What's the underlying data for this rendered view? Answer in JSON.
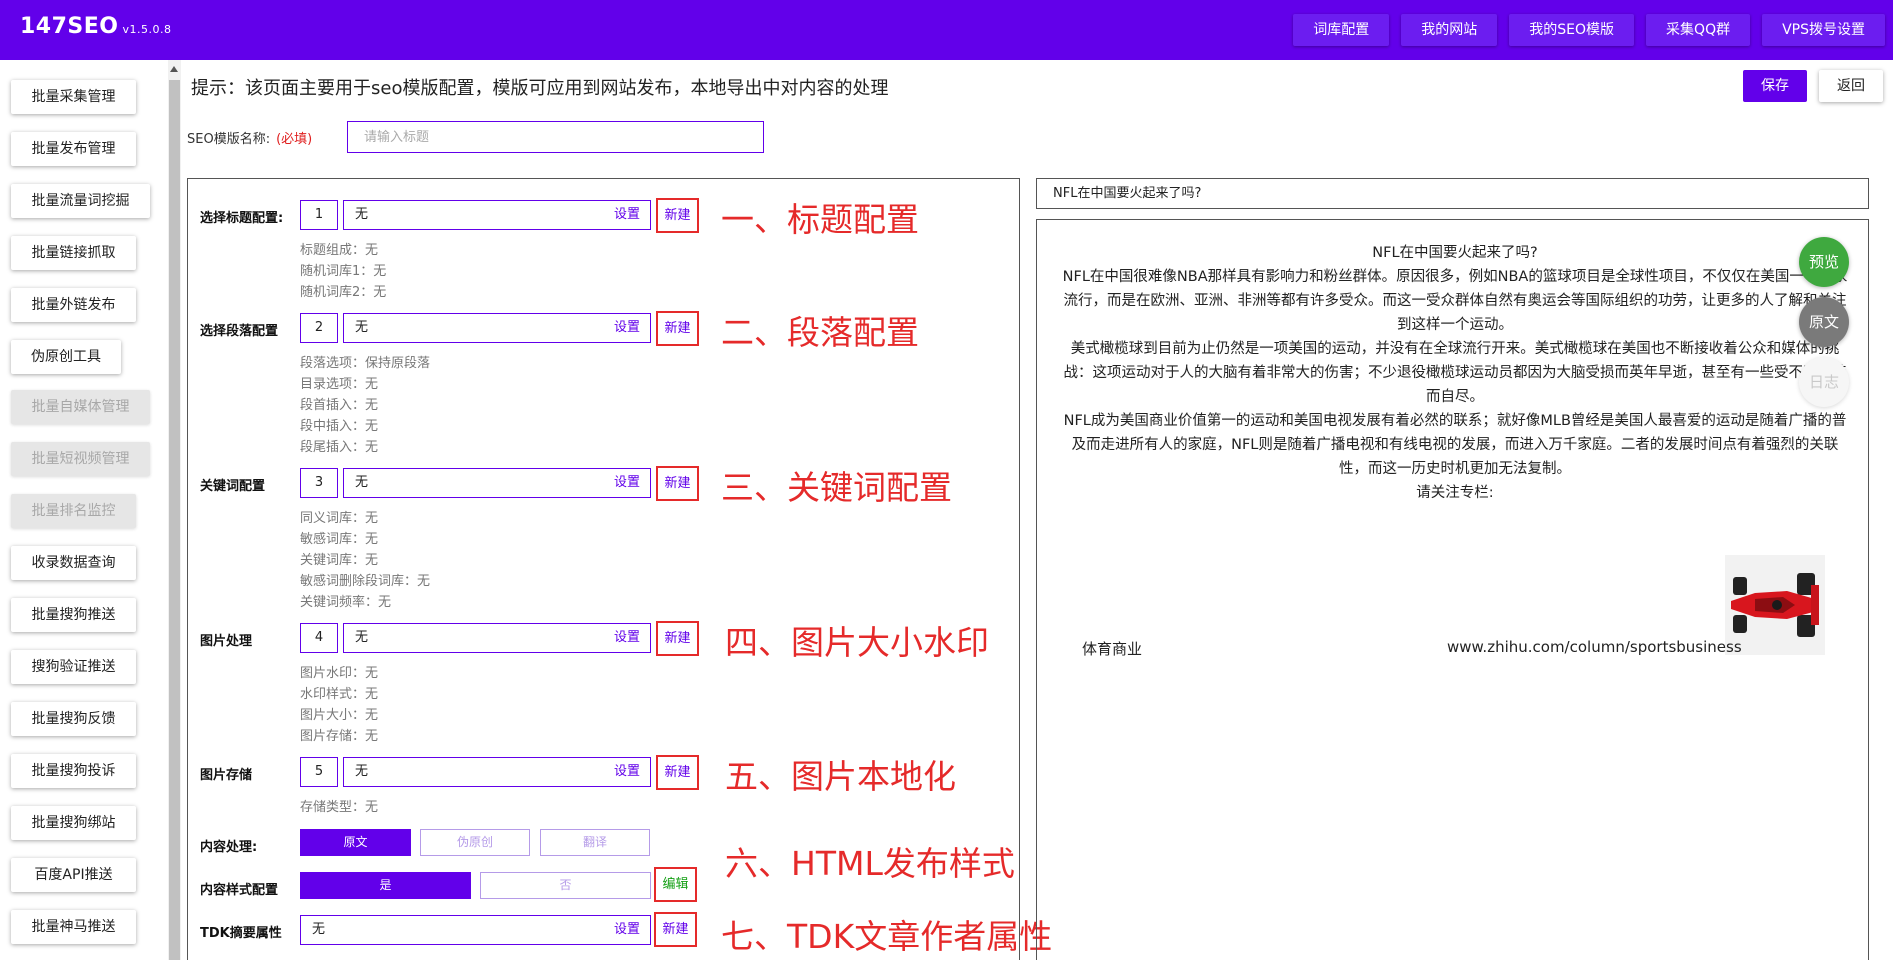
{
  "header": {
    "brand": "147SEO",
    "version": "v1.5.0.8",
    "nav": [
      "词库配置",
      "我的网站",
      "我的SEO模版",
      "采集QQ群",
      "VPS拨号设置"
    ]
  },
  "sidebar": {
    "items": [
      {
        "label": "批量采集管理",
        "disabled": false
      },
      {
        "label": "批量发布管理",
        "disabled": false
      },
      {
        "label": "批量流量词挖掘",
        "disabled": false
      },
      {
        "label": "批量链接抓取",
        "disabled": false
      },
      {
        "label": "批量外链发布",
        "disabled": false
      },
      {
        "label": "伪原创工具",
        "disabled": false
      },
      {
        "label": "批量自媒体管理",
        "disabled": true
      },
      {
        "label": "批量短视频管理",
        "disabled": true
      },
      {
        "label": "批量排名监控",
        "disabled": true
      },
      {
        "label": "收录数据查询",
        "disabled": false
      },
      {
        "label": "批量搜狗推送",
        "disabled": false
      },
      {
        "label": "搜狗验证推送",
        "disabled": false
      },
      {
        "label": "批量搜狗反馈",
        "disabled": false
      },
      {
        "label": "批量搜狗投诉",
        "disabled": false
      },
      {
        "label": "批量搜狗绑站",
        "disabled": false
      },
      {
        "label": "百度API推送",
        "disabled": false
      },
      {
        "label": "批量神马推送",
        "disabled": false
      }
    ]
  },
  "main": {
    "tip": "提示：该页面主要用于seo模版配置，模版可应用到网站发布，本地导出中对内容的处理",
    "save": "保存",
    "back": "返回",
    "template_label": "SEO模版名称:",
    "template_required": "(必填)",
    "template_placeholder": "请输入标题"
  },
  "config": {
    "rows": [
      {
        "label": "选择标题配置:",
        "num": "1",
        "value": "无",
        "set": "设置",
        "new": "新建",
        "annotation": "一、标题配置",
        "details": [
          "标题组成：无",
          "随机词库1：无",
          "随机词库2：无"
        ]
      },
      {
        "label": "选择段落配置",
        "num": "2",
        "value": "无",
        "set": "设置",
        "new": "新建",
        "annotation": "二、段落配置",
        "details": [
          "段落选项：保持原段落",
          "目录选项：无",
          "段首插入：无",
          "段中插入：无",
          "段尾插入：无"
        ]
      },
      {
        "label": "关键词配置",
        "num": "3",
        "value": "无",
        "set": "设置",
        "new": "新建",
        "annotation": "三、关键词配置",
        "details": [
          "同义词库：无",
          "敏感词库：无",
          "关键词库：无",
          "敏感词删除段词库：无",
          "关键词频率：无"
        ]
      },
      {
        "label": "图片处理",
        "num": "4",
        "value": "无",
        "set": "设置",
        "new": "新建",
        "annotation": "四、图片大小水印",
        "details": [
          "图片水印：无",
          "水印样式：无",
          "图片大小：无",
          "图片存储：无"
        ]
      },
      {
        "label": "图片存储",
        "num": "5",
        "value": "无",
        "set": "设置",
        "new": "新建",
        "annotation": "五、图片本地化",
        "details": [
          "存储类型：无"
        ]
      }
    ],
    "content_process": {
      "label": "内容处理:",
      "options": [
        "原文",
        "伪原创",
        "翻译"
      ],
      "selected": "原文",
      "annotation": "六、HTML发布样式"
    },
    "content_style": {
      "label": "内容样式配置",
      "options": [
        "是",
        "否"
      ],
      "selected": "是",
      "edit": "编辑"
    },
    "tdk": {
      "label": "TDK摘要属性",
      "value": "无",
      "set": "设置",
      "new": "新建",
      "annotation": "七、TDK文章作者属性"
    }
  },
  "preview": {
    "title_field": "NFL在中国要火起来了吗?",
    "body": {
      "heading": "NFL在中国要火起来了吗?",
      "p1": "NFL在中国很难像NBA那样具有影响力和粉丝群体。原因很多，例如NBA的篮球项目是全球性项目，不仅仅在美国一个国家流行，而是在欧洲、亚洲、非洲等都有许多受众。而这一受众群体自然有奥运会等国际组织的功劳，让更多的人了解和关注到这样一个运动。",
      "p2": "美式橄榄球到目前为止仍然是一项美国的运动，并没有在全球流行开来。美式橄榄球在美国也不断接收着公众和媒体的挑战：这项运动对于人的大脑有着非常大的伤害；不少退役橄榄球运动员都因为大脑受损而英年早逝，甚至有一些受不了痛苦而自尽。",
      "p3": "NFL成为美国商业价值第一的运动和美国电视发展有着必然的联系；就好像MLB曾经是美国人最喜爱的运动是随着广播的普及而走进所有人的家庭，NFL则是随着广播电视和有线电视的发展，而进入万千家庭。二者的发展时间点有着强烈的关联性，而这一历史时机更加无法复制。",
      "p4": "请关注专栏:",
      "footer_left": "体育商业",
      "footer_url": "www.zhihu.com/column/sportsbusiness"
    },
    "fab": {
      "preview": "预览",
      "original": "原文",
      "log": "日志"
    }
  },
  "colors": {
    "brand": "#6200ea",
    "annotation": "#e52a2a",
    "preview_green": "#3fa93f"
  }
}
